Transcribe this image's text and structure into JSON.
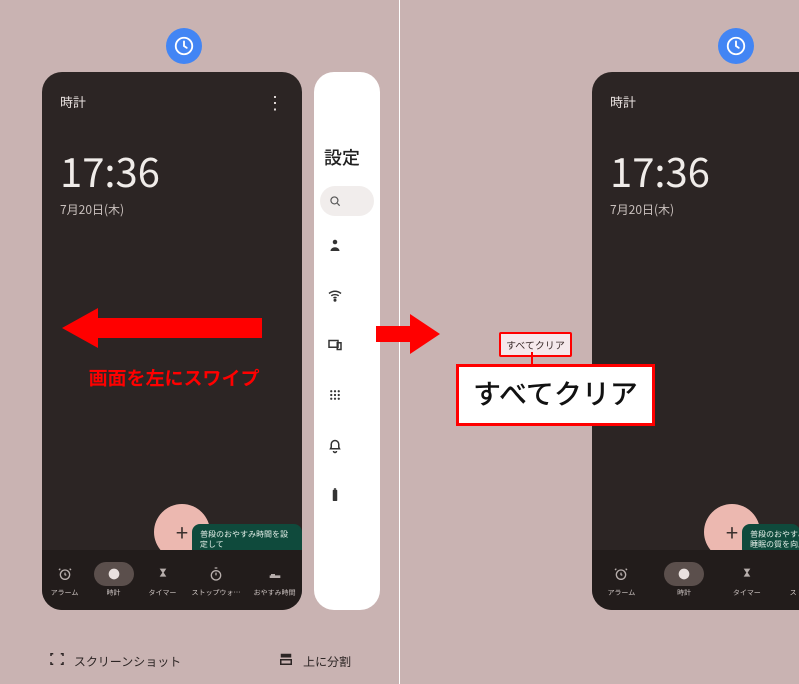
{
  "clock": {
    "title": "時計",
    "time": "17:36",
    "date": "7月20日(木)",
    "tip_line1": "普段のおやすみ時間を設定して",
    "tip_line2": "睡眠の質を向上させましょう",
    "tip_line2_clipped": "睡眠の質を向上させ",
    "tip_line1_clipped": "普段のおやすみ時間",
    "fab_plus": "+"
  },
  "nav": {
    "alarm": "アラーム",
    "clock": "時計",
    "timer": "タイマー",
    "stopwatch": "ストップウォ…",
    "bedtime": "おやすみ時間"
  },
  "settings_sliver": {
    "title": "設定"
  },
  "annotation": {
    "swipe_caption": "画面を左にスワイプ",
    "clear_all": "すべてクリア"
  },
  "footer": {
    "screenshot": "スクリーンショット",
    "split_top": "上に分割"
  }
}
